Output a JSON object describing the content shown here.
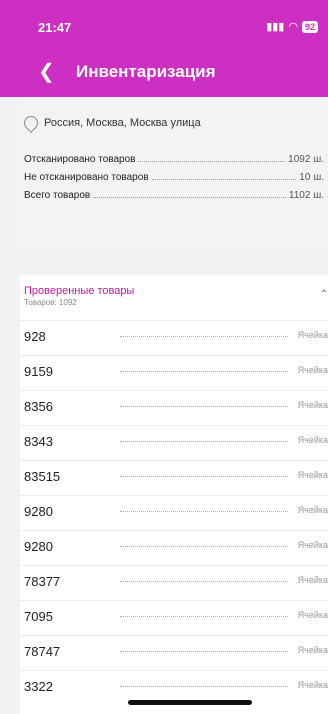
{
  "status": {
    "time": "21:47",
    "battery": "92"
  },
  "header": {
    "back_icon": "chevron-left-icon",
    "title": "Инвентаризация"
  },
  "location": {
    "icon": "location-pin-icon",
    "text": "Россия, Москва, Москва улица"
  },
  "stats": [
    {
      "label": "Отсканировано товаров",
      "value": "1092 ш."
    },
    {
      "label": "Не отсканировано товаров",
      "value": "10 ш."
    },
    {
      "label": "Всего товаров",
      "value": "1102 ш."
    }
  ],
  "section": {
    "title": "Проверенные товары",
    "count_label": "Товаров: 1092",
    "items": [
      {
        "code": "928",
        "cell": "Ячейка"
      },
      {
        "code": "9159",
        "cell": "Ячейка"
      },
      {
        "code": "8356",
        "cell": "Ячейка"
      },
      {
        "code": "8343",
        "cell": "Ячейка"
      },
      {
        "code": "83515",
        "cell": "Ячейка"
      },
      {
        "code": "9280",
        "cell": "Ячейка"
      },
      {
        "code": "9280",
        "cell": "Ячейка"
      },
      {
        "code": "78377",
        "cell": "Ячейка"
      },
      {
        "code": "7095",
        "cell": "Ячейка"
      },
      {
        "code": "78747",
        "cell": "Ячейка"
      },
      {
        "code": "3322",
        "cell": "Ячейка"
      }
    ]
  },
  "colors": {
    "primary": "#cc2fc2",
    "section_title": "#c2189f"
  }
}
